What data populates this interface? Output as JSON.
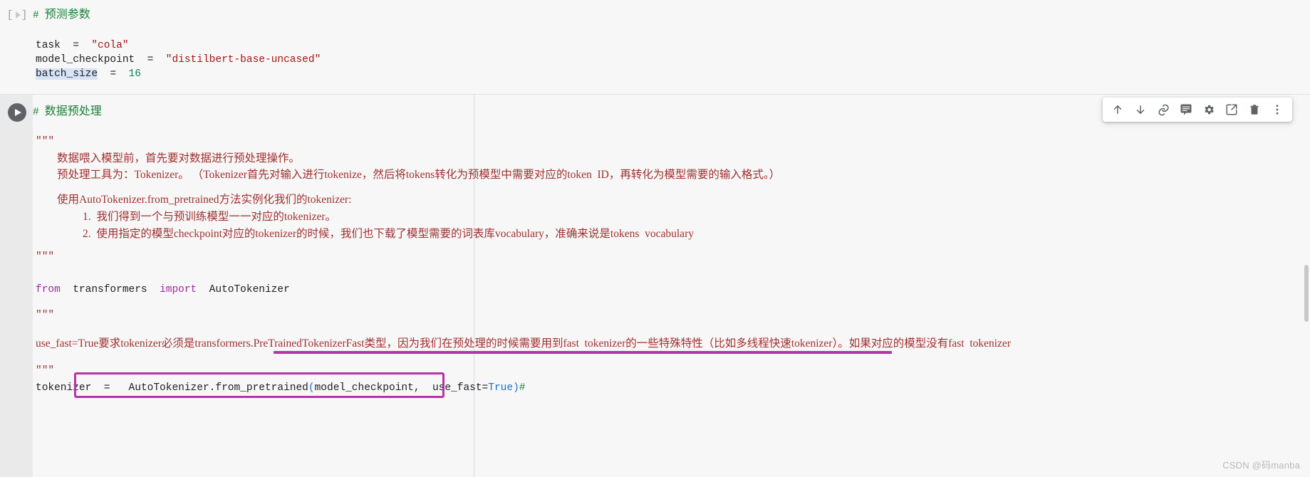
{
  "notebook": {
    "cells": [
      {
        "id": "params-cell",
        "run_indicator": "[ ]",
        "heading_hash": "#",
        "heading_text": "预测参数",
        "lines": [
          {
            "name": "task-line",
            "var": "task",
            "eq": "=",
            "value": "\"cola\""
          },
          {
            "name": "checkpoint-line",
            "var": "model_checkpoint",
            "eq": "=",
            "value": "\"distilbert-base-uncased\""
          },
          {
            "name": "batch-size-line",
            "var": "batch_size",
            "eq": "=",
            "value": "16"
          }
        ]
      },
      {
        "id": "preprocess-cell",
        "heading_hash": "#",
        "heading_text": "数据预处理",
        "docstring_open": "\"\"\"",
        "docstring_close": "\"\"\"",
        "doc_lines": [
          "数据喂入模型前，首先要对数据进行预处理操作。",
          "预处理工具为：Tokenizer。 （Tokenizer首先对输入进行tokenize，然后将tokens转化为预模型中需要对应的token  ID，再转化为模型需要的输入格式。）",
          "使用AutoTokenizer.from_pretrained方法实例化我们的tokenizer:",
          "1.  我们得到一个与预训练模型一一对应的tokenizer。",
          "2.  使用指定的模型checkpoint对应的tokenizer的时候，我们也下载了模型需要的词表库vocabulary，准确来说是tokens  vocabulary"
        ],
        "import_line": {
          "kw_from": "from",
          "module": "transformers",
          "kw_import": "import",
          "name": "AutoTokenizer"
        },
        "doc2_open": "\"\"\"",
        "doc2_text": "use_fast=True要求tokenizer必须是transformers.PreTrainedTokenizerFast类型，因为我们在预处理的时候需要用到fast  tokenizer的一些特殊特性（比如多线程快速tokenizer）。如果对应的模型没有fast  tokenizer",
        "doc2_close": "\"\"\"",
        "tokenizer_line": {
          "var": "tokenizer",
          "eq": "=",
          "call_head": "AutoTokenizer.from_pretrained",
          "paren_open": "(",
          "arg1": "model_checkpoint,",
          "arg2": "use_fast=",
          "arg2_value": "True",
          "paren_close": ")",
          "trailing_hash": "#"
        }
      }
    ]
  },
  "toolbar": {
    "items": [
      {
        "name": "move-cell-up-button",
        "label": "向上移动单元格"
      },
      {
        "name": "move-cell-down-button",
        "label": "向下移动单元格"
      },
      {
        "name": "copy-cell-link-button",
        "label": "复制单元格链接"
      },
      {
        "name": "add-comment-button",
        "label": "添加备注"
      },
      {
        "name": "cell-settings-button",
        "label": "单元格设置"
      },
      {
        "name": "mirror-cell-button",
        "label": "镜像单元格"
      },
      {
        "name": "delete-cell-button",
        "label": "删除单元格"
      },
      {
        "name": "more-options-button",
        "label": "更多单元格操作"
      }
    ]
  },
  "annotations": {
    "underline": {
      "name": "highlight-underline",
      "color": "#b832a8"
    },
    "box": {
      "name": "highlight-box",
      "color": "#b832a8"
    }
  },
  "watermark": {
    "text": "CSDN @码manba"
  }
}
